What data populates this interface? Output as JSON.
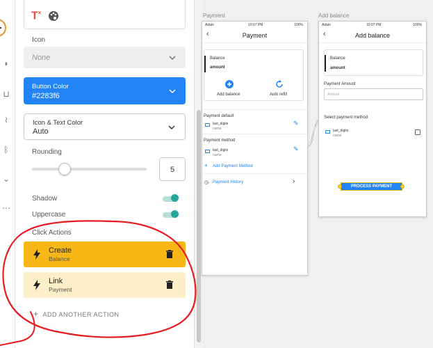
{
  "panel": {
    "icon_label": "Icon",
    "icon_value": "None",
    "button_color_label": "Button Color",
    "button_color_value": "#2283f6",
    "icon_text_color_label": "Icon & Text Color",
    "icon_text_color_value": "Auto",
    "rounding_label": "Rounding",
    "rounding_value": "5",
    "rounding_fraction": 0.29,
    "shadow_label": "Shadow",
    "shadow_on": true,
    "uppercase_label": "Uppercase",
    "uppercase_on": true,
    "click_actions_label": "Click Actions",
    "actions": [
      {
        "title": "Create",
        "subtitle": "Balance"
      },
      {
        "title": "Link",
        "subtitle": "Payment"
      }
    ],
    "add_action_label": "ADD ANOTHER ACTION"
  },
  "screens": {
    "payment_screen_label": "Payment",
    "add_balance_screen_label": "Add balance",
    "payment": {
      "carrier": "Adalo",
      "time": "10:07 PM",
      "battery": "100%",
      "title": "Payment",
      "balance_label": "Balance",
      "balance_value": "amount",
      "add_balance_label": "Add balance",
      "auto_refill_label": "Auto refill",
      "payment_default_label": "Payment default",
      "payment_method_label": "Payment method",
      "card_digits": "last_digits",
      "card_name": "name",
      "add_payment_method_label": "Add Payment Method",
      "payment_history_label": "Payment History"
    },
    "add_balance": {
      "carrier": "Adalo",
      "time": "10:07 PM",
      "battery": "100%",
      "title": "Add balance",
      "balance_label": "Balance",
      "balance_value": "amount",
      "payment_amount_label": "Payment Amount",
      "amount_placeholder": "Amount",
      "select_method_label": "Select payment method",
      "card_digits": "last_digits",
      "card_name": "name",
      "process_button_label": "PROCESS PAYMENT"
    }
  },
  "colors": {
    "accent_blue": "#2283f6",
    "create_card": "#f7b716",
    "link_card": "#fdf0c8",
    "toggle_on": "#26a69a",
    "annotation_red": "#e8191f"
  }
}
